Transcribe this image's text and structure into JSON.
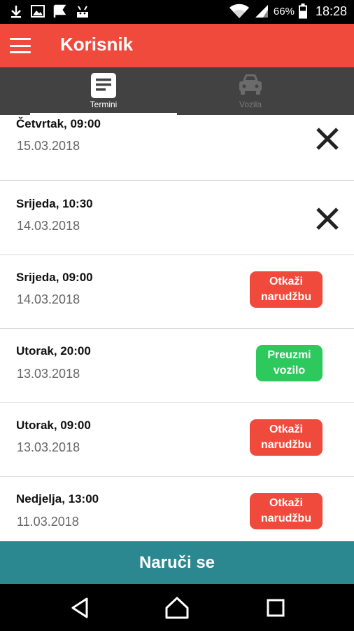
{
  "status_bar": {
    "battery_percent": "66%",
    "time": "18:28"
  },
  "app_bar": {
    "title": "Korisnik",
    "menu_icon": "hamburger-menu-icon"
  },
  "tabs": [
    {
      "label": "Termini",
      "icon": "list-icon",
      "selected": true
    },
    {
      "label": "Vozila",
      "icon": "car-icon",
      "selected": false
    }
  ],
  "appointments": [
    {
      "day_time": "Četvrtak, 09:00",
      "date": "15.03.2018",
      "action": "close-icon"
    },
    {
      "day_time": "Srijeda, 10:30",
      "date": "14.03.2018",
      "action": "close-icon"
    },
    {
      "day_time": "Srijeda, 09:00",
      "date": "14.03.2018",
      "action_line1": "Otkaži",
      "action_line2": "narudžbu"
    },
    {
      "day_time": "Utorak, 20:00",
      "date": "13.03.2018",
      "action_line1": "Preuzmi",
      "action_line2": "vozilo"
    },
    {
      "day_time": "Utorak, 09:00",
      "date": "13.03.2018",
      "action_line1": "Otkaži",
      "action_line2": "narudžbu"
    },
    {
      "day_time": "Nedjelja, 13:00",
      "date": "11.03.2018",
      "action_line1": "Otkaži",
      "action_line2": "narudžbu"
    }
  ],
  "order_button": {
    "label": "Naruči se"
  },
  "colors": {
    "app_bar": "#ef4a3c",
    "tab_bar": "#424242",
    "cancel_pill": "#ef4a3c",
    "pickup_pill": "#2ec95c",
    "order_button": "#2b8790"
  }
}
